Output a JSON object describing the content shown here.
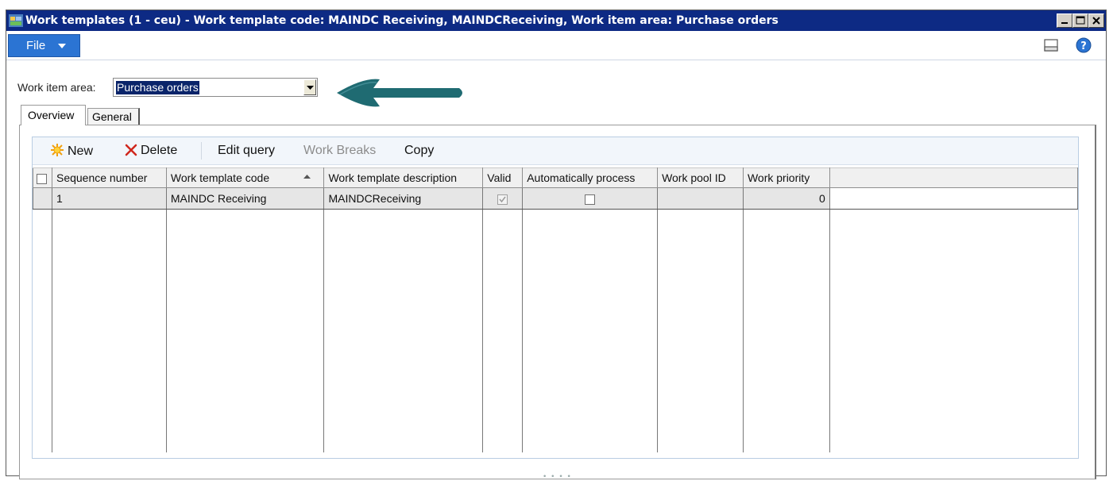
{
  "window": {
    "title": "Work templates (1 - ceu) - Work template code: MAINDC Receiving, MAINDCReceiving, Work item area: Purchase orders"
  },
  "ribbon": {
    "file_label": "File"
  },
  "filter": {
    "work_item_area_label": "Work item area:",
    "work_item_area_value": "Purchase orders"
  },
  "tabs": [
    {
      "label": "Overview",
      "active": true
    },
    {
      "label": "General",
      "active": false
    }
  ],
  "toolbar": {
    "new_label": "New",
    "delete_label": "Delete",
    "edit_query_label": "Edit query",
    "work_breaks_label": "Work Breaks",
    "copy_label": "Copy"
  },
  "grid": {
    "columns": [
      "Sequence number",
      "Work template code",
      "Work template description",
      "Valid",
      "Automatically process",
      "Work pool ID",
      "Work priority"
    ],
    "rows": [
      {
        "sequence_number": "1",
        "work_template_code": "MAINDC Receiving",
        "work_template_description": "MAINDCReceiving",
        "valid": true,
        "automatically_process": false,
        "work_pool_id": "",
        "work_priority": "0"
      }
    ]
  },
  "colors": {
    "titlebar": "#0d2a84",
    "file_button": "#2b74d3",
    "arrow": "#1f6b72",
    "selected_value": "#0a246a"
  }
}
